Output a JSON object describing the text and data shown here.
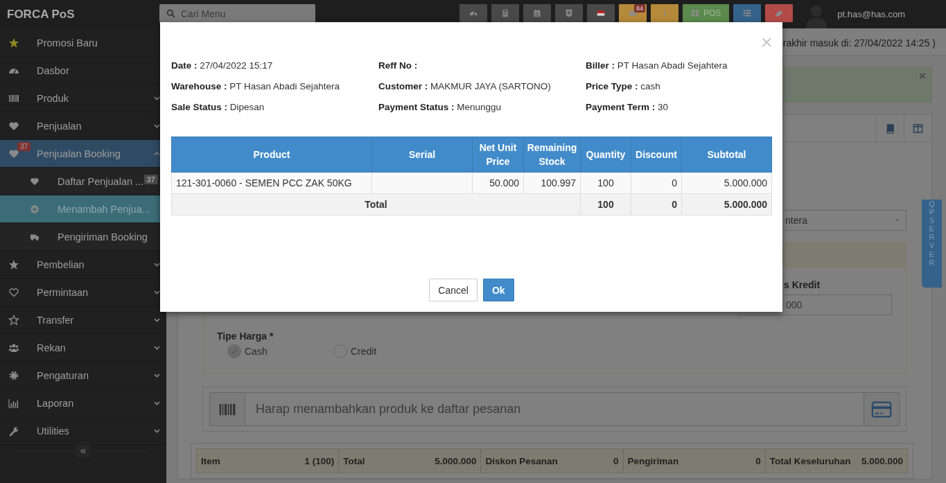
{
  "topbar": {
    "brand": "FORCA PoS",
    "search": {
      "placeholder": "Cari Menu"
    },
    "buttons": [
      {
        "color": "#494949"
      },
      {
        "color": "#494949"
      },
      {
        "color": "#494949"
      },
      {
        "color": "#494949"
      },
      {
        "color": "#494949"
      },
      {
        "color": "#b58a3a",
        "badge": "84"
      },
      {
        "color": "#b58a3a"
      },
      {
        "color": "#5c8a4e",
        "label": "POS"
      },
      {
        "color": "#35628a"
      },
      {
        "color": "#b24b48"
      }
    ],
    "user": "pt.has@has.com"
  },
  "sidebar": {
    "items": [
      {
        "label": "Promosi Baru",
        "selected": false
      },
      {
        "label": "Dasbor",
        "selected": false
      },
      {
        "label": "Produk",
        "selected": false,
        "expanded": false
      },
      {
        "label": "Penjualan",
        "selected": false,
        "expanded": false
      },
      {
        "label": "Penjualan Booking",
        "selected": true,
        "expanded": true,
        "badge": "37",
        "children": [
          {
            "label": "Daftar Penjualan ...",
            "selected": false,
            "badge": "37"
          },
          {
            "label": "Menambah Penjua...",
            "selected": true
          },
          {
            "label": "Pengiriman Booking",
            "selected": false
          }
        ]
      },
      {
        "label": "Pembelian",
        "selected": false,
        "expanded": false
      },
      {
        "label": "Permintaan",
        "selected": false,
        "expanded": false
      },
      {
        "label": "Transfer",
        "selected": false,
        "expanded": false
      },
      {
        "label": "Rekan",
        "selected": false,
        "expanded": false
      },
      {
        "label": "Pengaturan",
        "selected": false,
        "expanded": false
      },
      {
        "label": "Laporan",
        "selected": false,
        "expanded": false
      },
      {
        "label": "Utilities",
        "selected": false,
        "expanded": false
      }
    ],
    "collapse": "«"
  },
  "page": {
    "last_login": "rakhir masuk di: 27/04/2022 14:25 )",
    "alert_close": "×",
    "select_value": "ntera",
    "credit_label": "s Kredit",
    "credit_value": "000",
    "price_type": {
      "label": "Tipe Harga *",
      "options": [
        {
          "label": "Cash",
          "selected": true
        },
        {
          "label": "Credit",
          "selected": false
        }
      ]
    },
    "product_search": {
      "placeholder": "Harap menambahkan produk ke daftar pesanan"
    },
    "totals": [
      {
        "label": "Item",
        "value": "1 (100)"
      },
      {
        "label": "Total",
        "value": "5.000.000"
      },
      {
        "label": "Diskon Pesanan",
        "value": "0"
      },
      {
        "label": "Pengiriman",
        "value": "0"
      },
      {
        "label": "Total Keseluruhan",
        "value": "5.000.000"
      }
    ],
    "side_tab": "QP SERVER"
  },
  "modal": {
    "close": "×",
    "fields": [
      {
        "label": "Date :",
        "value": "27/04/2022 15:17"
      },
      {
        "label": "Reff No :"
      },
      {
        "label": "Biller :",
        "value": "PT Hasan Abadi Sejahtera"
      },
      {
        "label": "Warehouse :",
        "value": "PT Hasan Abadi Sejahtera"
      },
      {
        "label": "Customer :",
        "value": "MAKMUR JAYA (SARTONO)"
      },
      {
        "label": "Price Type :",
        "value": "cash"
      },
      {
        "label": "Sale Status :",
        "value": "Dipesan"
      },
      {
        "label": "Payment Status :",
        "value": "Menunggu"
      },
      {
        "label": "Payment Term :",
        "value": "30"
      }
    ],
    "table": {
      "columns": [
        "Product",
        "Serial",
        "Net Unit Price",
        "Remaining Stock",
        "Quantity",
        "Discount",
        "Subtotal"
      ],
      "rows": [
        [
          "121-301-0060 - SEMEN PCC ZAK 50KG",
          "",
          "50.000",
          "100.997",
          "100",
          "0",
          "5.000.000"
        ]
      ],
      "total": {
        "label": "Total",
        "quantity": "100",
        "discount": "0",
        "subtotal": "5.000.000"
      }
    },
    "buttons": [
      {
        "label": "Cancel",
        "kind": "secondary"
      },
      {
        "label": "Ok",
        "kind": "primary"
      }
    ]
  }
}
